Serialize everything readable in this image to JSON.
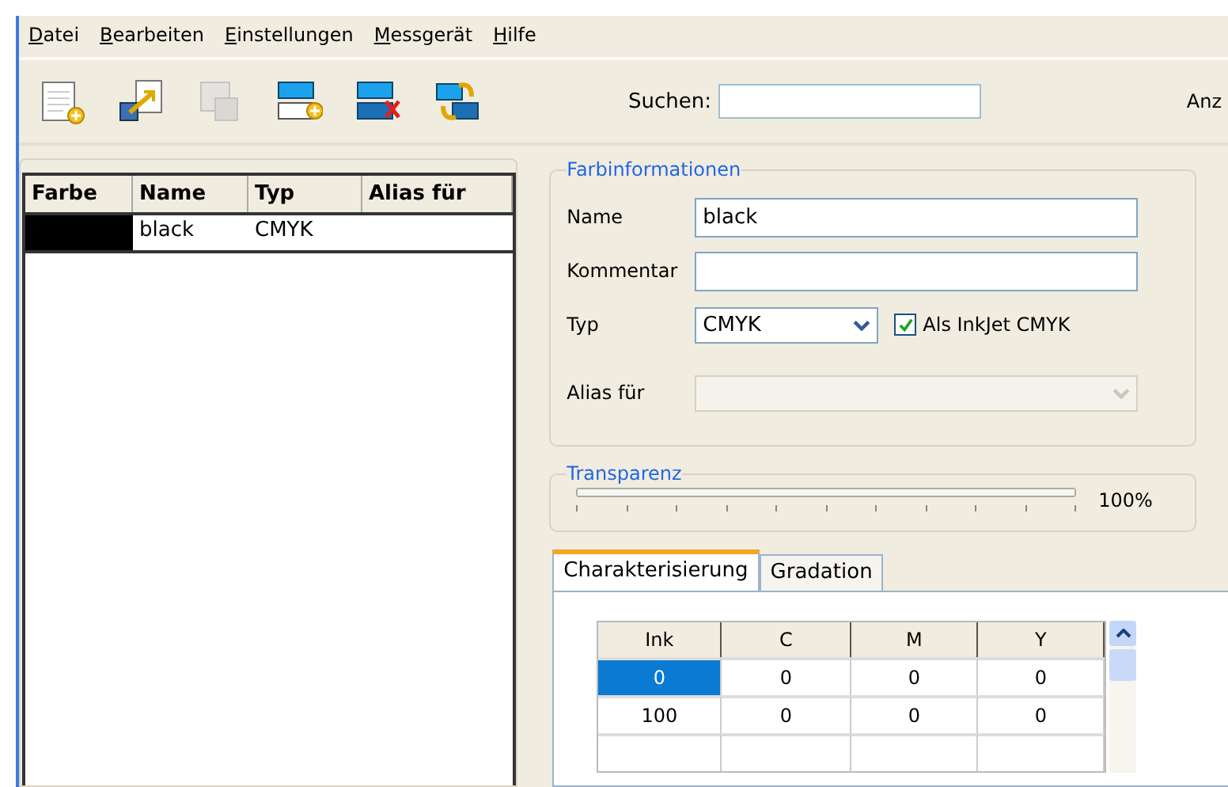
{
  "menu": [
    "Datei",
    "Bearbeiten",
    "Einstellungen",
    "Messgerät",
    "Hilfe"
  ],
  "toolbar": [
    {
      "kind": "new-sheet",
      "disabled": false
    },
    {
      "kind": "import",
      "disabled": false
    },
    {
      "kind": "copy",
      "disabled": true
    },
    {
      "kind": "add-color",
      "disabled": false
    },
    {
      "kind": "delete-color",
      "disabled": false
    },
    {
      "kind": "swap",
      "disabled": false
    }
  ],
  "search": {
    "label": "Suchen:"
  },
  "toolbar_right_label": "Anz",
  "color_list": {
    "columns": [
      "Farbe",
      "Name",
      "Typ",
      "Alias für"
    ],
    "rows": [
      {
        "color": "#000000",
        "name": "black",
        "type": "CMYK"
      }
    ]
  },
  "color_info": {
    "title": "Farbinformationen",
    "name": {
      "label": "Name",
      "value": "black"
    },
    "comment": {
      "label": "Kommentar"
    },
    "type": {
      "label": "Typ",
      "value": "CMYK"
    },
    "inkjet": {
      "label": "Als InkJet CMYK",
      "checked": true
    },
    "alias": {
      "label": "Alias für",
      "disabled": true
    }
  },
  "transparency": {
    "title": "Transparenz",
    "level": 1.0,
    "reading": "100%"
  },
  "tabs": [
    {
      "label": "Charakterisierung",
      "selected": true
    },
    {
      "label": "Gradation",
      "selected": false
    }
  ],
  "table": {
    "columns": [
      "Ink",
      "C",
      "M",
      "Y"
    ],
    "rows": [
      {
        "cells": [
          {
            "text": "0",
            "selected": true
          },
          {
            "text": "0",
            "selected": false
          },
          {
            "text": "0",
            "selected": false
          },
          {
            "text": "0",
            "selected": false
          }
        ]
      },
      {
        "cells": [
          {
            "text": "100",
            "selected": false
          },
          {
            "text": "0",
            "selected": false
          },
          {
            "text": "0",
            "selected": false
          },
          {
            "text": "0",
            "selected": false
          }
        ]
      }
    ]
  }
}
